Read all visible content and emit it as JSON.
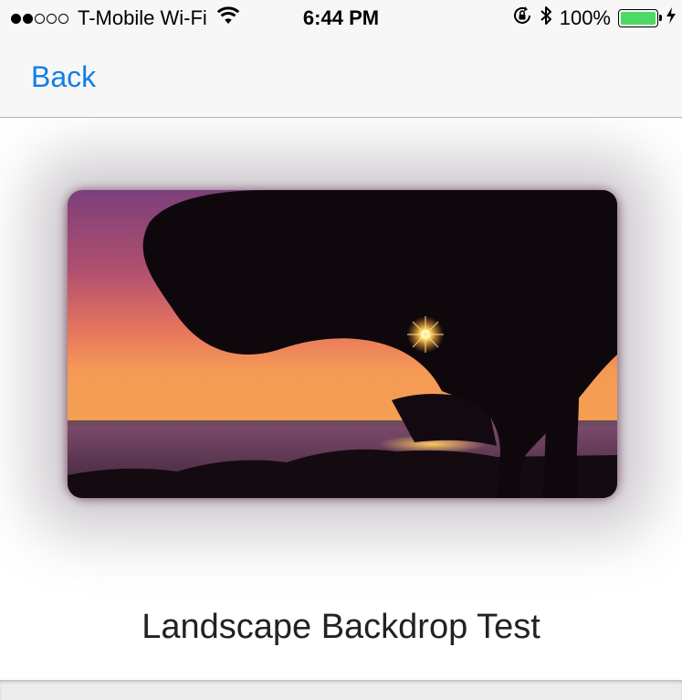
{
  "status_bar": {
    "carrier": "T-Mobile Wi-Fi",
    "signal_bars_filled": 2,
    "signal_bars_total": 5,
    "time": "6:44 PM",
    "battery_percent": "100%",
    "battery_level": 1.0,
    "battery_color": "#4cd964",
    "icons": [
      "wifi-icon",
      "orientation-lock-icon",
      "bluetooth-icon",
      "battery-icon",
      "charging-bolt-icon"
    ]
  },
  "nav": {
    "back_label": "Back",
    "accent_color": "#117ee8"
  },
  "main": {
    "image_subject": "sunset-tree-landscape",
    "caption": "Landscape Backdrop Test"
  }
}
